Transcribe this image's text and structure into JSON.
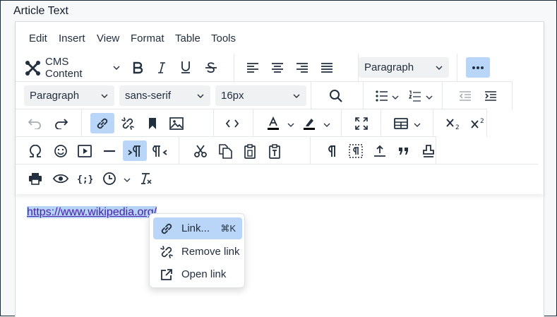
{
  "field": {
    "label": "Article Text"
  },
  "menubar": {
    "items": [
      "Edit",
      "Insert",
      "View",
      "Format",
      "Table",
      "Tools"
    ]
  },
  "toolbar": {
    "cms_label": "CMS Content",
    "block_format": "Paragraph",
    "block_format2": "Paragraph",
    "font_family": "sans-serif",
    "font_size": "16px"
  },
  "content": {
    "link_text": "https://www.wikipedia.org/"
  },
  "context_menu": {
    "items": [
      {
        "label": "Link...",
        "shortcut": "⌘K",
        "icon": "link-icon",
        "highlighted": true
      },
      {
        "label": "Remove link",
        "icon": "unlink-icon"
      },
      {
        "label": "Open link",
        "icon": "open-link-icon"
      }
    ]
  },
  "colors": {
    "accent": "#b9d5f7",
    "link": "#4b1fa8",
    "selection": "#b4d3f5"
  }
}
